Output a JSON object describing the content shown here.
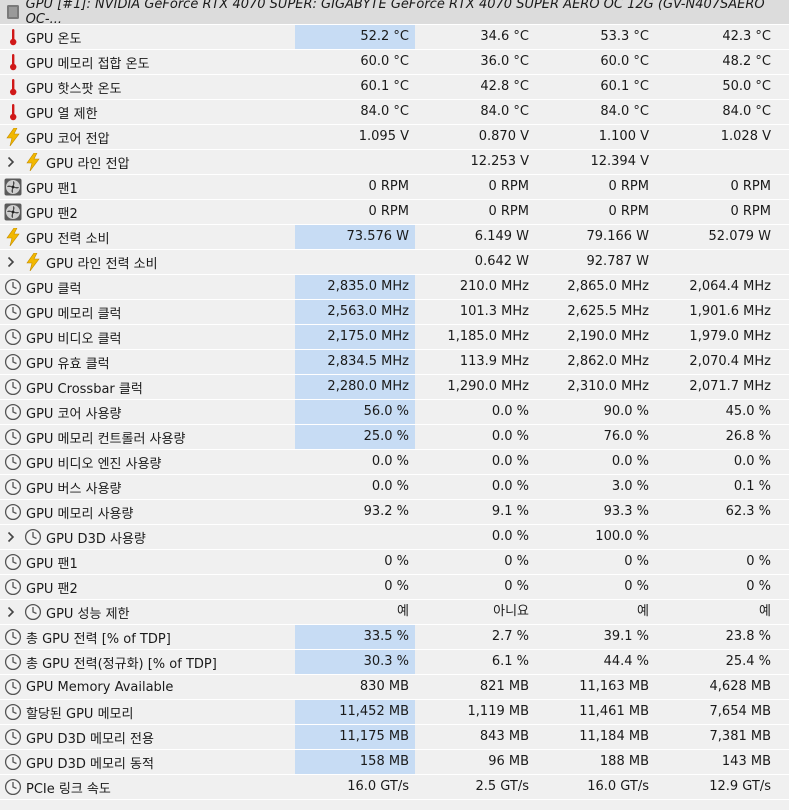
{
  "header": {
    "title": "GPU [#1]: NVIDIA GeForce RTX 4070 SUPER: GIGABYTE GeForce RTX 4070 SUPER AERO OC 12G (GV-N407SAERO OC-...",
    "icon": "gpu-chip-icon"
  },
  "colors": {
    "highlight": "#c7dcf4",
    "thermometer": "#d01818",
    "bolt": "#f2b800",
    "background": "#f0f0f0"
  },
  "rows": [
    {
      "label": "GPU 온도",
      "icon": "thermometer",
      "expand": false,
      "cur": "52.2 °C",
      "min": "34.6 °C",
      "max": "53.3 °C",
      "avg": "42.3 °C",
      "hl": true
    },
    {
      "label": "GPU 메모리 접합 온도",
      "icon": "thermometer",
      "expand": false,
      "cur": "60.0 °C",
      "min": "36.0 °C",
      "max": "60.0 °C",
      "avg": "48.2 °C",
      "hl": false
    },
    {
      "label": "GPU 핫스팟 온도",
      "icon": "thermometer",
      "expand": false,
      "cur": "60.1 °C",
      "min": "42.8 °C",
      "max": "60.1 °C",
      "avg": "50.0 °C",
      "hl": false
    },
    {
      "label": "GPU 열 제한",
      "icon": "thermometer",
      "expand": false,
      "cur": "84.0 °C",
      "min": "84.0 °C",
      "max": "84.0 °C",
      "avg": "84.0 °C",
      "hl": false
    },
    {
      "label": "GPU 코어 전압",
      "icon": "bolt",
      "expand": false,
      "cur": "1.095 V",
      "min": "0.870 V",
      "max": "1.100 V",
      "avg": "1.028 V",
      "hl": false
    },
    {
      "label": "GPU 라인 전압",
      "icon": "bolt",
      "expand": true,
      "cur": "",
      "min": "12.253 V",
      "max": "12.394 V",
      "avg": "",
      "hl": false
    },
    {
      "label": "GPU 팬1",
      "icon": "fan",
      "expand": false,
      "cur": "0 RPM",
      "min": "0 RPM",
      "max": "0 RPM",
      "avg": "0 RPM",
      "hl": false
    },
    {
      "label": "GPU 팬2",
      "icon": "fan",
      "expand": false,
      "cur": "0 RPM",
      "min": "0 RPM",
      "max": "0 RPM",
      "avg": "0 RPM",
      "hl": false
    },
    {
      "label": "GPU 전력 소비",
      "icon": "bolt",
      "expand": false,
      "cur": "73.576 W",
      "min": "6.149 W",
      "max": "79.166 W",
      "avg": "52.079 W",
      "hl": true
    },
    {
      "label": "GPU 라인 전력 소비",
      "icon": "bolt",
      "expand": true,
      "cur": "",
      "min": "0.642 W",
      "max": "92.787 W",
      "avg": "",
      "hl": false
    },
    {
      "label": "GPU 클럭",
      "icon": "clock",
      "expand": false,
      "cur": "2,835.0 MHz",
      "min": "210.0 MHz",
      "max": "2,865.0 MHz",
      "avg": "2,064.4 MHz",
      "hl": true
    },
    {
      "label": "GPU 메모리 클럭",
      "icon": "clock",
      "expand": false,
      "cur": "2,563.0 MHz",
      "min": "101.3 MHz",
      "max": "2,625.5 MHz",
      "avg": "1,901.6 MHz",
      "hl": true
    },
    {
      "label": "GPU 비디오 클럭",
      "icon": "clock",
      "expand": false,
      "cur": "2,175.0 MHz",
      "min": "1,185.0 MHz",
      "max": "2,190.0 MHz",
      "avg": "1,979.0 MHz",
      "hl": true
    },
    {
      "label": "GPU 유효 클럭",
      "icon": "clock",
      "expand": false,
      "cur": "2,834.5 MHz",
      "min": "113.9 MHz",
      "max": "2,862.0 MHz",
      "avg": "2,070.4 MHz",
      "hl": true
    },
    {
      "label": "GPU Crossbar 클럭",
      "icon": "clock",
      "expand": false,
      "cur": "2,280.0 MHz",
      "min": "1,290.0 MHz",
      "max": "2,310.0 MHz",
      "avg": "2,071.7 MHz",
      "hl": true
    },
    {
      "label": "GPU 코어 사용량",
      "icon": "clock",
      "expand": false,
      "cur": "56.0 %",
      "min": "0.0 %",
      "max": "90.0 %",
      "avg": "45.0 %",
      "hl": true
    },
    {
      "label": "GPU 메모리 컨트롤러 사용량",
      "icon": "clock",
      "expand": false,
      "cur": "25.0 %",
      "min": "0.0 %",
      "max": "76.0 %",
      "avg": "26.8 %",
      "hl": true
    },
    {
      "label": "GPU 비디오 엔진 사용량",
      "icon": "clock",
      "expand": false,
      "cur": "0.0 %",
      "min": "0.0 %",
      "max": "0.0 %",
      "avg": "0.0 %",
      "hl": false
    },
    {
      "label": "GPU 버스 사용량",
      "icon": "clock",
      "expand": false,
      "cur": "0.0 %",
      "min": "0.0 %",
      "max": "3.0 %",
      "avg": "0.1 %",
      "hl": false
    },
    {
      "label": "GPU 메모리 사용량",
      "icon": "clock",
      "expand": false,
      "cur": "93.2 %",
      "min": "9.1 %",
      "max": "93.3 %",
      "avg": "62.3 %",
      "hl": false
    },
    {
      "label": "GPU D3D 사용량",
      "icon": "clock",
      "expand": true,
      "cur": "",
      "min": "0.0 %",
      "max": "100.0 %",
      "avg": "",
      "hl": false
    },
    {
      "label": "GPU 팬1",
      "icon": "clock",
      "expand": false,
      "cur": "0 %",
      "min": "0 %",
      "max": "0 %",
      "avg": "0 %",
      "hl": false
    },
    {
      "label": "GPU 팬2",
      "icon": "clock",
      "expand": false,
      "cur": "0 %",
      "min": "0 %",
      "max": "0 %",
      "avg": "0 %",
      "hl": false
    },
    {
      "label": "GPU 성능 제한",
      "icon": "clock",
      "expand": true,
      "cur": "예",
      "min": "아니요",
      "max": "예",
      "avg": "예",
      "hl": false
    },
    {
      "label": "총 GPU 전력 [% of TDP]",
      "icon": "clock",
      "expand": false,
      "cur": "33.5 %",
      "min": "2.7 %",
      "max": "39.1 %",
      "avg": "23.8 %",
      "hl": true
    },
    {
      "label": "총 GPU 전력(정규화) [% of TDP]",
      "icon": "clock",
      "expand": false,
      "cur": "30.3 %",
      "min": "6.1 %",
      "max": "44.4 %",
      "avg": "25.4 %",
      "hl": true
    },
    {
      "label": "GPU Memory Available",
      "icon": "clock",
      "expand": false,
      "cur": "830 MB",
      "min": "821 MB",
      "max": "11,163 MB",
      "avg": "4,628 MB",
      "hl": false
    },
    {
      "label": "할당된 GPU 메모리",
      "icon": "clock",
      "expand": false,
      "cur": "11,452 MB",
      "min": "1,119 MB",
      "max": "11,461 MB",
      "avg": "7,654 MB",
      "hl": true
    },
    {
      "label": "GPU D3D 메모리 전용",
      "icon": "clock",
      "expand": false,
      "cur": "11,175 MB",
      "min": "843 MB",
      "max": "11,184 MB",
      "avg": "7,381 MB",
      "hl": true
    },
    {
      "label": "GPU D3D 메모리 동적",
      "icon": "clock",
      "expand": false,
      "cur": "158 MB",
      "min": "96 MB",
      "max": "188 MB",
      "avg": "143 MB",
      "hl": true
    },
    {
      "label": "PCIe 링크 속도",
      "icon": "clock",
      "expand": false,
      "cur": "16.0 GT/s",
      "min": "2.5 GT/s",
      "max": "16.0 GT/s",
      "avg": "12.9 GT/s",
      "hl": false
    }
  ]
}
